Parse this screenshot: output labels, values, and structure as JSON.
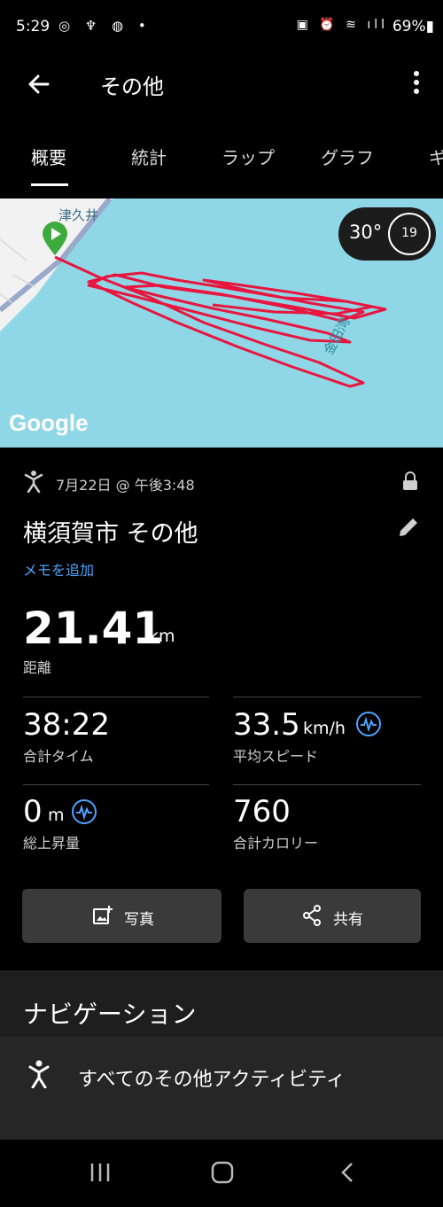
{
  "status_bar": {
    "time": "5:29",
    "left_icons": "◎ ♆ ◍ •",
    "right_icons": "▣ ⏰ ≋ ıll",
    "battery": "69%▮"
  },
  "app_bar": {
    "title": "その他"
  },
  "tabs": [
    {
      "label": "概要",
      "active": true
    },
    {
      "label": "統計"
    },
    {
      "label": "ラップ"
    },
    {
      "label": "グラフ"
    },
    {
      "label": "ギ"
    }
  ],
  "map": {
    "label_top": "津久井",
    "label_bay": "金田湾",
    "temperature": "30°",
    "wind": "19",
    "logo": "Google"
  },
  "activity": {
    "date": "7月22日 @ 午後3:48",
    "title": "横須賀市 その他",
    "add_memo": "メモを追加"
  },
  "distance": {
    "value": "21.41",
    "unit": "km",
    "label": "距離"
  },
  "stats": {
    "time": {
      "value": "38:22",
      "label": "合計タイム"
    },
    "speed": {
      "value": "33.5",
      "unit": "km/h",
      "label": "平均スピード"
    },
    "elevation": {
      "value": "0",
      "unit": "m",
      "label": "総上昇量"
    },
    "calories": {
      "value": "760",
      "label": "合計カロリー"
    }
  },
  "actions": {
    "photo": "写真",
    "share": "共有"
  },
  "navigation": {
    "heading": "ナビゲーション",
    "item": "すべてのその他アクティビティ"
  },
  "colors": {
    "accent": "#4ea3ff",
    "route": "#e8163f",
    "water": "#8fd7e6",
    "start_pin": "#3daa3d"
  }
}
